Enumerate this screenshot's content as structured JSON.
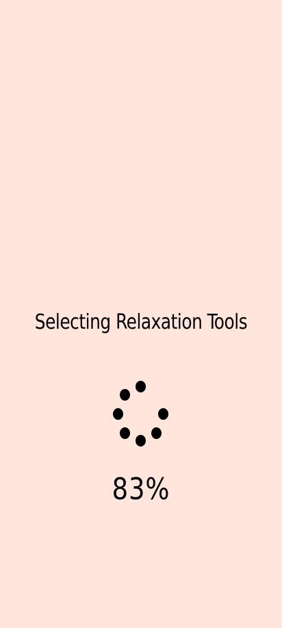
{
  "loading": {
    "title": "Selecting Relaxation Tools",
    "progress_text": "83%",
    "progress": 0.83,
    "spinner_icon": "loading-dots-spinner-icon"
  },
  "colors": {
    "background": "#ffe5dc",
    "text": "#000000",
    "spinner": "#000000"
  }
}
